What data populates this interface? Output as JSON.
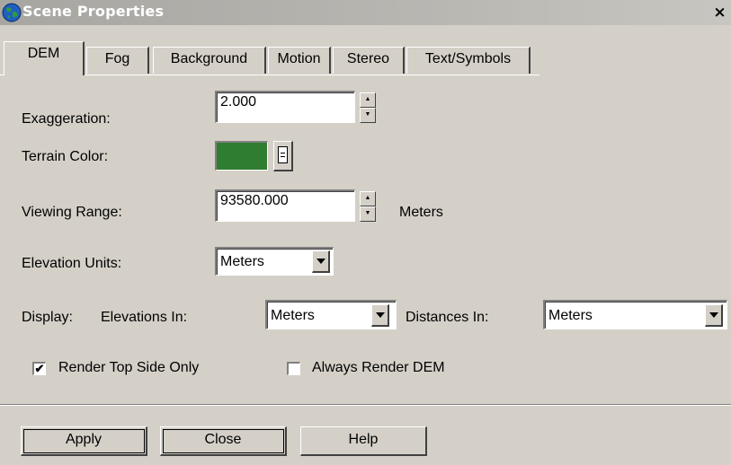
{
  "window": {
    "title": "Scene Properties",
    "close_glyph": "×"
  },
  "tabs": [
    {
      "label": "DEM",
      "active": true
    },
    {
      "label": "Fog",
      "active": false
    },
    {
      "label": "Background",
      "active": false
    },
    {
      "label": "Motion",
      "active": false
    },
    {
      "label": "Stereo",
      "active": false
    },
    {
      "label": "Text/Symbols",
      "active": false
    }
  ],
  "form": {
    "exaggeration": {
      "label": "Exaggeration:",
      "value": "2.000"
    },
    "terrain_color": {
      "label": "Terrain Color:",
      "color": "#2e7d30"
    },
    "viewing_range": {
      "label": "Viewing Range:",
      "value": "93580.000",
      "unit": "Meters"
    },
    "elevation_units": {
      "label": "Elevation Units:",
      "value": "Meters"
    },
    "display": {
      "label": "Display:",
      "elevations_label": "Elevations In:",
      "elevations_value": "Meters",
      "distances_label": "Distances In:",
      "distances_value": "Meters"
    },
    "render_top_side_only": {
      "label": "Render Top Side Only",
      "checked": true,
      "mark": "✔"
    },
    "always_render_dem": {
      "label": "Always Render DEM",
      "checked": false
    }
  },
  "buttons": {
    "apply": "Apply",
    "close": "Close",
    "help": "Help"
  },
  "spinner": {
    "up": "▲",
    "down": "▼"
  }
}
